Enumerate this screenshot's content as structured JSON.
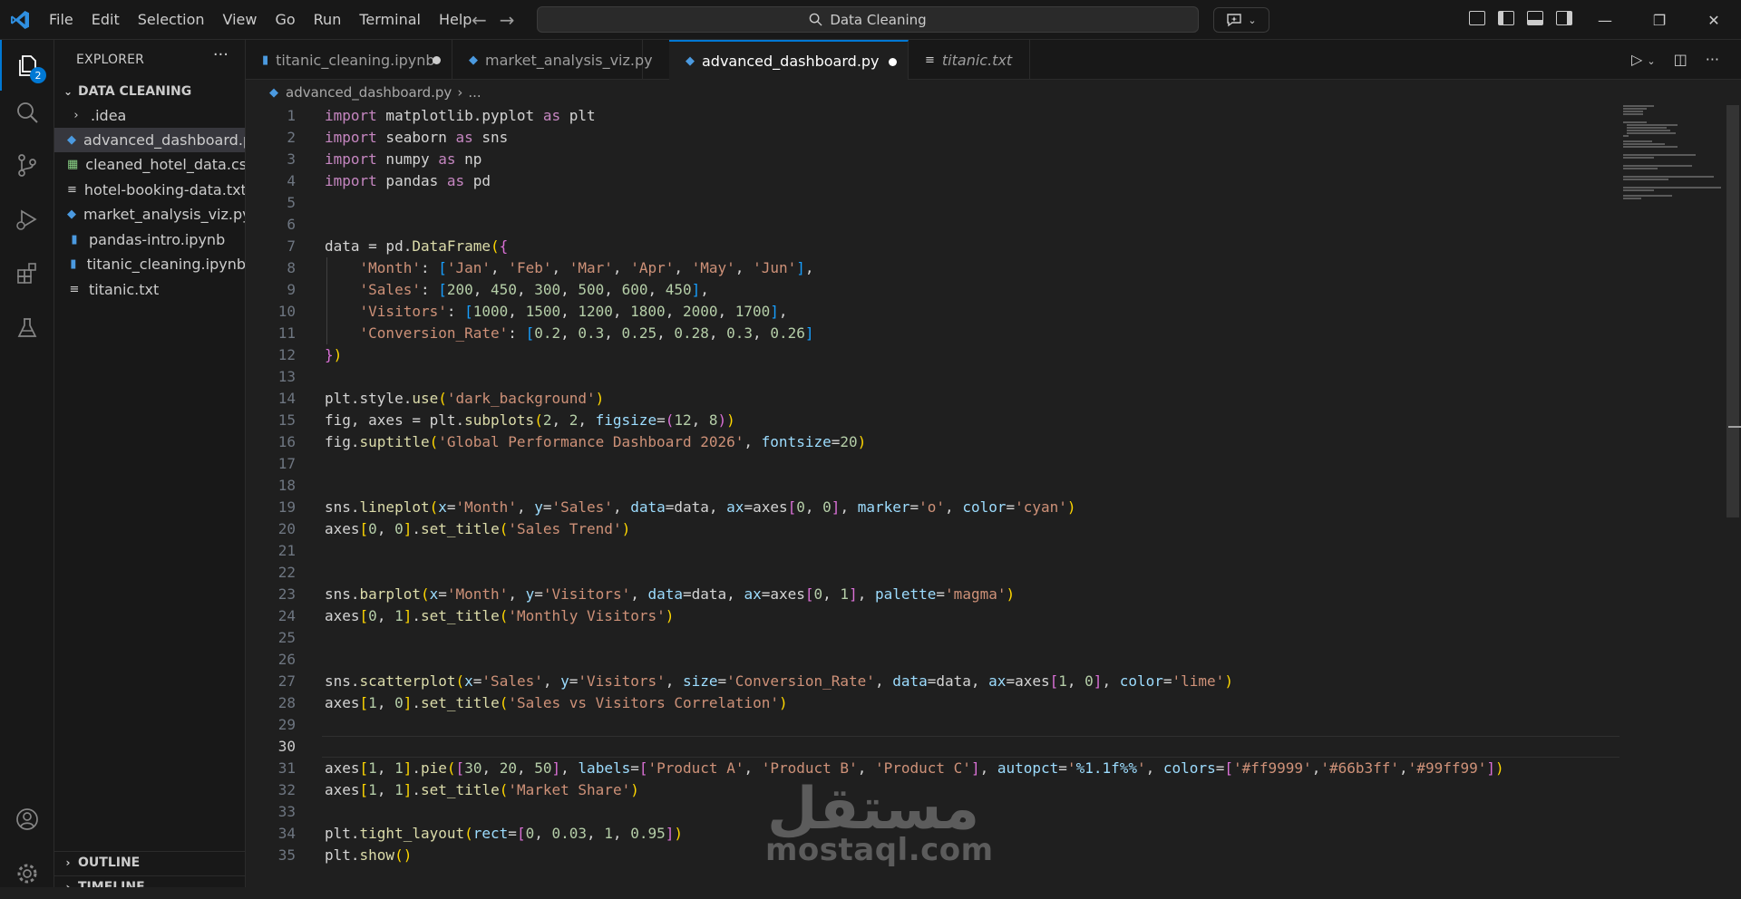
{
  "menu": [
    "File",
    "Edit",
    "Selection",
    "View",
    "Go",
    "Run",
    "Terminal",
    "Help"
  ],
  "search": {
    "label": "Data Cleaning"
  },
  "activity": {
    "explorer_badge": "2"
  },
  "sidebar": {
    "title": "EXPLORER",
    "more": "···",
    "folder": "DATA CLEANING",
    "items": [
      {
        "label": ".idea",
        "type": "folder"
      },
      {
        "label": "advanced_dashboard.py",
        "type": "py"
      },
      {
        "label": "cleaned_hotel_data.csv",
        "type": "csv"
      },
      {
        "label": "hotel-booking-data.txt",
        "type": "txt"
      },
      {
        "label": "market_analysis_viz.py",
        "type": "py"
      },
      {
        "label": "pandas-intro.ipynb",
        "type": "ipynb"
      },
      {
        "label": "titanic_cleaning.ipynb",
        "type": "ipynb"
      },
      {
        "label": "titanic.txt",
        "type": "txt"
      }
    ],
    "outline": "OUTLINE",
    "timeline": "TIMELINE"
  },
  "tabs": [
    {
      "label": "titanic_cleaning.ipynb",
      "modified": true
    },
    {
      "label": "market_analysis_viz.py",
      "modified": false
    },
    {
      "label": "advanced_dashboard.py",
      "modified": true,
      "active": true
    },
    {
      "label": "titanic.txt",
      "modified": false,
      "preview": true
    }
  ],
  "breadcrumb": {
    "file": "advanced_dashboard.py",
    "rest": "..."
  },
  "editor": {
    "current_line": "30"
  },
  "watermark": {
    "arabic": "مستقل",
    "latin": "mostaql.com"
  },
  "colors": {
    "accent": "#0078d4",
    "python": "#4b9ae0",
    "csv": "#89d185",
    "ipynb": "#4b9ae0"
  }
}
